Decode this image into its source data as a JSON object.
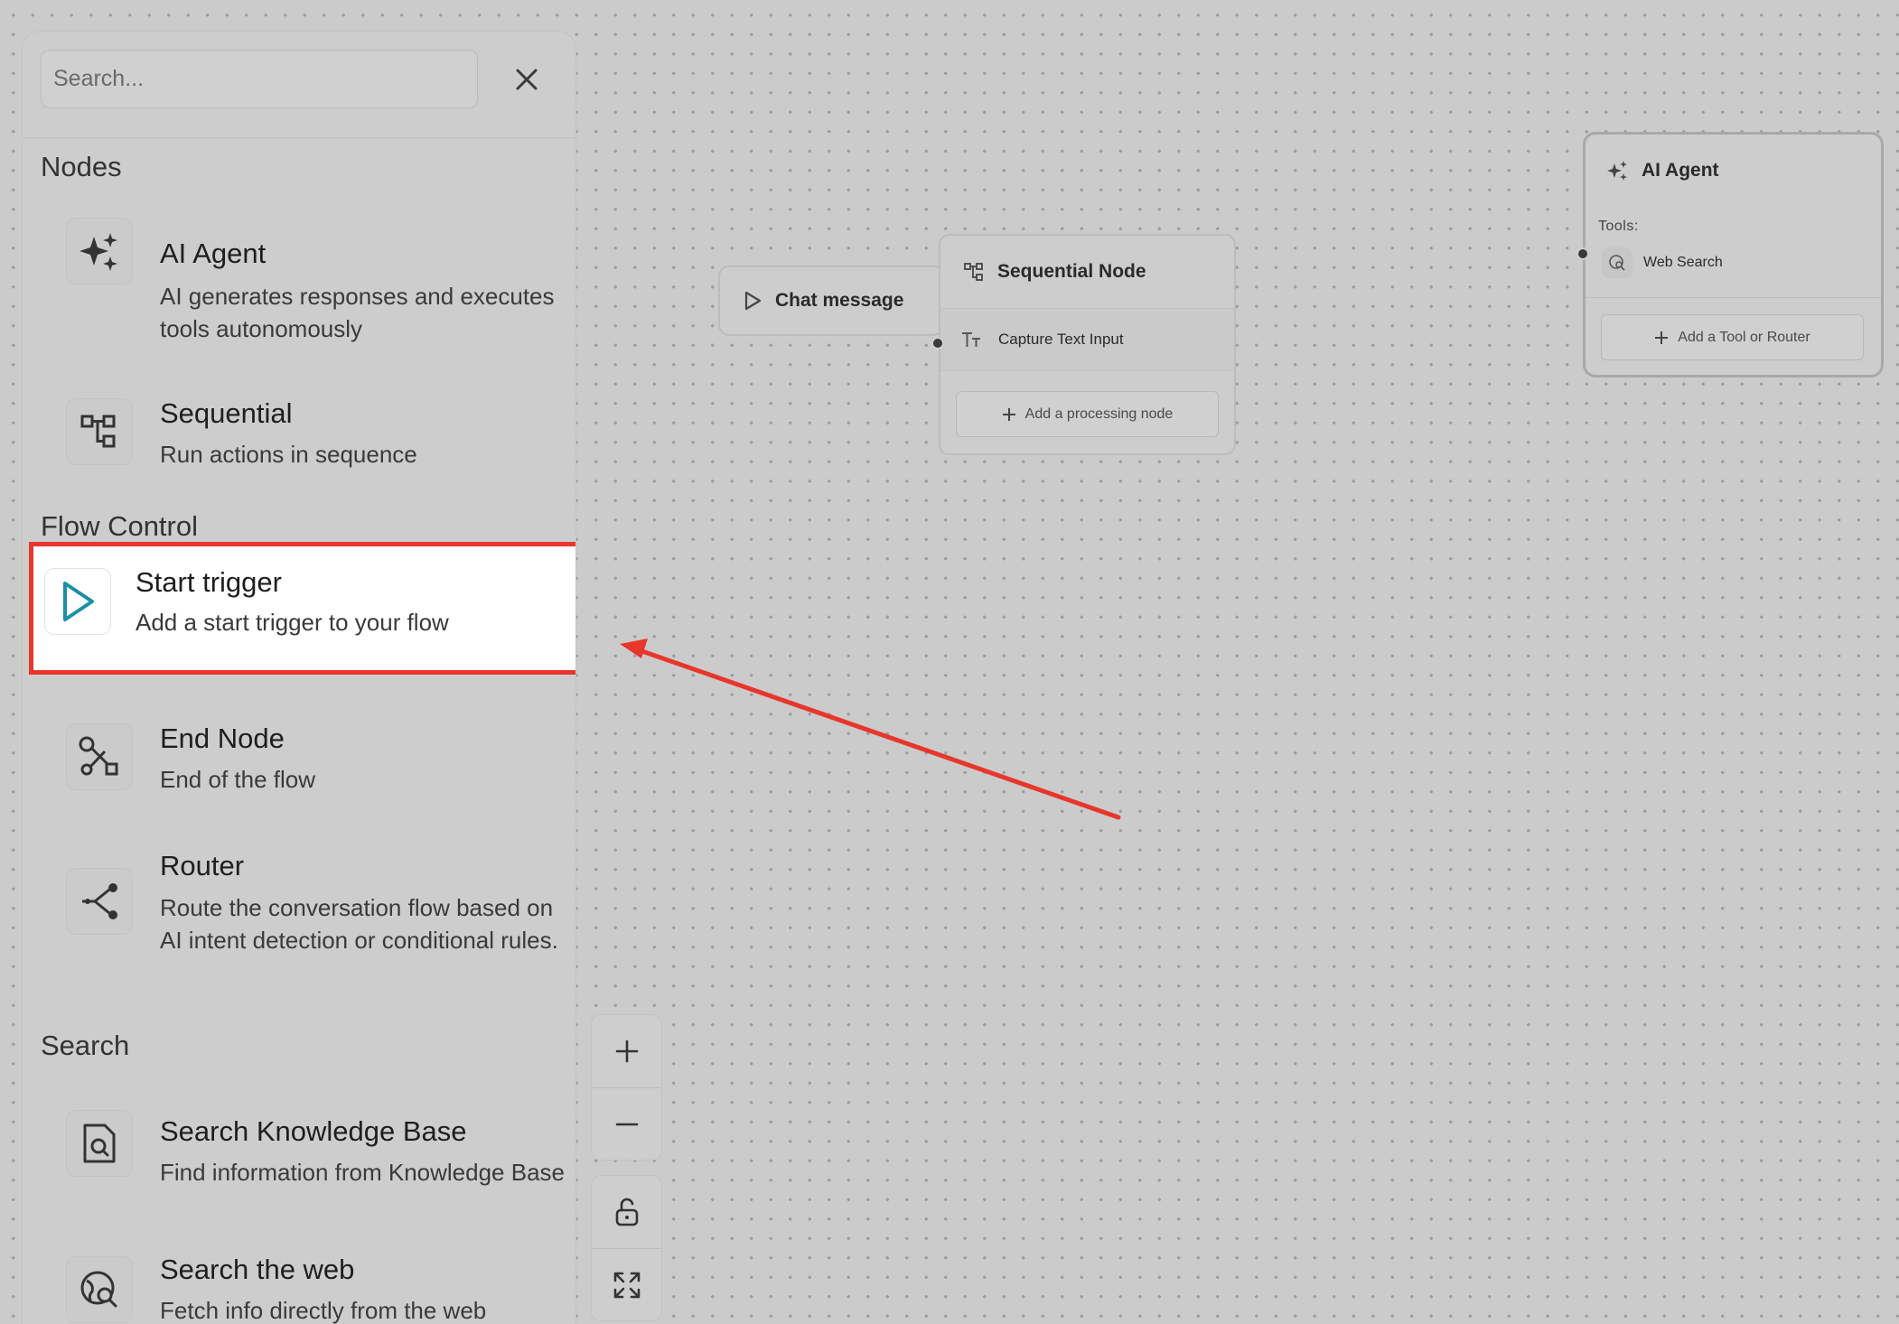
{
  "sidebar": {
    "search_placeholder": "Search...",
    "sections": {
      "nodes": "Nodes",
      "flow_control": "Flow Control",
      "search": "Search"
    },
    "items": {
      "ai_agent": {
        "title": "AI Agent",
        "desc": "AI generates responses and executes tools autonomously"
      },
      "sequential": {
        "title": "Sequential",
        "desc": "Run actions in sequence"
      },
      "start_trigger": {
        "title": "Start trigger",
        "desc": "Add a start trigger to your flow"
      },
      "end_node": {
        "title": "End Node",
        "desc": "End of the flow"
      },
      "router": {
        "title": "Router",
        "desc": "Route the conversation flow based on AI intent detection or conditional rules."
      },
      "search_kb": {
        "title": "Search Knowledge Base",
        "desc": "Find information from Knowledge Base"
      },
      "search_web": {
        "title": "Search the web",
        "desc": "Fetch info directly from the web"
      }
    }
  },
  "canvas": {
    "chat_node": {
      "label": "Chat message"
    },
    "sequential_node": {
      "title": "Sequential Node",
      "row_label": "Capture Text Input",
      "add_label": "Add a processing node"
    },
    "agent_node": {
      "title": "AI Agent",
      "tools_label": "Tools:",
      "tool_label": "Web Search",
      "add_label": "Add a Tool or Router"
    }
  },
  "colors": {
    "highlight_border": "#e8362d",
    "arrow": "#e8362d",
    "accent_teal": "#1a8fa6"
  }
}
